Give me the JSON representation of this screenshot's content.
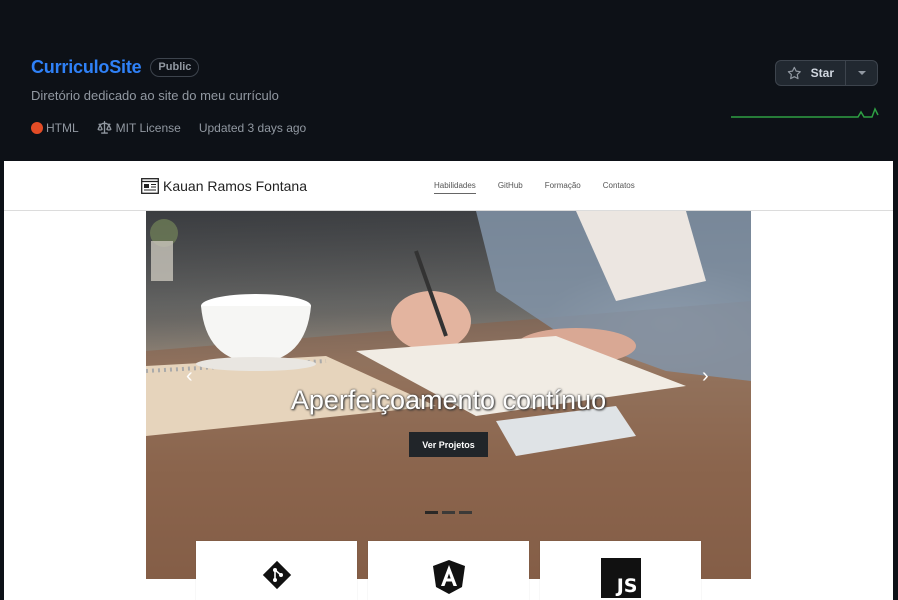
{
  "repo": {
    "name": "CurriculoSite",
    "visibility": "Public",
    "description": "Diretório dedicado ao site do meu currículo",
    "language": "HTML",
    "language_color": "#e34c26",
    "license": "MIT License",
    "updated": "Updated 3 days ago"
  },
  "star": {
    "label": "Star"
  },
  "site": {
    "brand": "Kauan Ramos Fontana",
    "nav": [
      "Habilidades",
      "GitHub",
      "Formação",
      "Contatos"
    ],
    "carousel": {
      "caption": "Aperfeiçoamento contínuo",
      "button": "Ver Projetos",
      "prev": "‹",
      "next": "›",
      "slides": 3,
      "active_slide": 1
    },
    "cards": [
      {
        "icon": "git-icon"
      },
      {
        "icon": "angular-icon"
      },
      {
        "icon": "javascript-icon",
        "label": "JS"
      }
    ]
  }
}
